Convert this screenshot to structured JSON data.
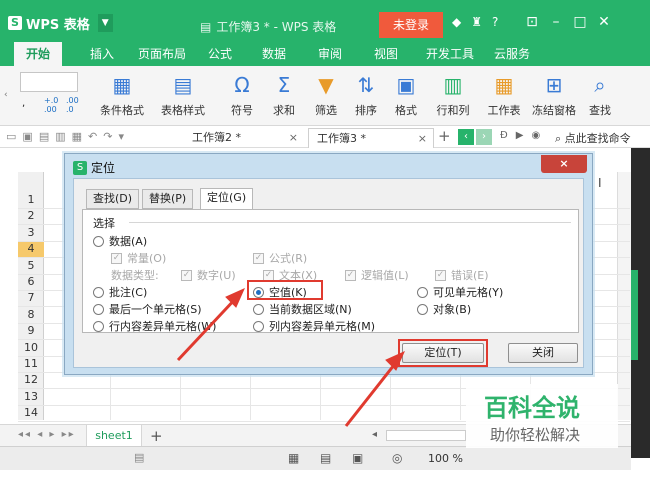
{
  "app": {
    "logo_label": "WPS 表格",
    "window_title": "工作簿3 * - WPS 表格",
    "login_button": "未登录",
    "help_label": "?"
  },
  "tabs": [
    "开始",
    "插入",
    "页面布局",
    "公式",
    "数据",
    "审阅",
    "视图",
    "开发工具",
    "云服务"
  ],
  "ribbon": {
    "number_decimals": [
      ".00",
      ".0"
    ],
    "buttons": [
      "条件格式",
      "表格样式",
      "符号",
      "求和",
      "筛选",
      "排序",
      "格式",
      "行和列",
      "工作表",
      "冻结窗格",
      "查找"
    ]
  },
  "docbar": {
    "tabs": [
      {
        "label": "工作簿2 *"
      },
      {
        "label": "工作簿3 *"
      }
    ],
    "finder": "点此查找命令"
  },
  "sheet": {
    "rows": [
      "1",
      "2",
      "3",
      "4",
      "5",
      "6",
      "7",
      "8",
      "9",
      "10",
      "11",
      "12",
      "13",
      "14"
    ],
    "highlight_row": "4",
    "tab": "sheet1",
    "zoom": "100 %"
  },
  "dialog": {
    "title": "定位",
    "close": "×",
    "tabs": [
      "查找(D)",
      "替换(P)",
      "定位(G)"
    ],
    "group_label": "选择",
    "options": {
      "data": "数据(A)",
      "constant": "常量(O)",
      "formula": "公式(R)",
      "data_type": "数据类型:",
      "number": "数字(U)",
      "text": "文本(X)",
      "logical": "逻辑值(L)",
      "error": "错误(E)",
      "comment": "批注(C)",
      "blank": "空值(K)",
      "visible": "可见单元格(Y)",
      "last_cell": "最后一个单元格(S)",
      "current_region": "当前数据区域(N)",
      "object": "对象(B)",
      "row_diff": "行内容差异单元格(W)",
      "col_diff": "列内容差异单元格(M)"
    },
    "ok": "定位(T)",
    "close_btn": "关闭"
  },
  "watermark": {
    "title": "百科全说",
    "subtitle": "助你轻松解决"
  },
  "colors": {
    "brand_green": "#27b36b",
    "login_red": "#f05a3c",
    "annotation_red": "#e03a2f"
  }
}
